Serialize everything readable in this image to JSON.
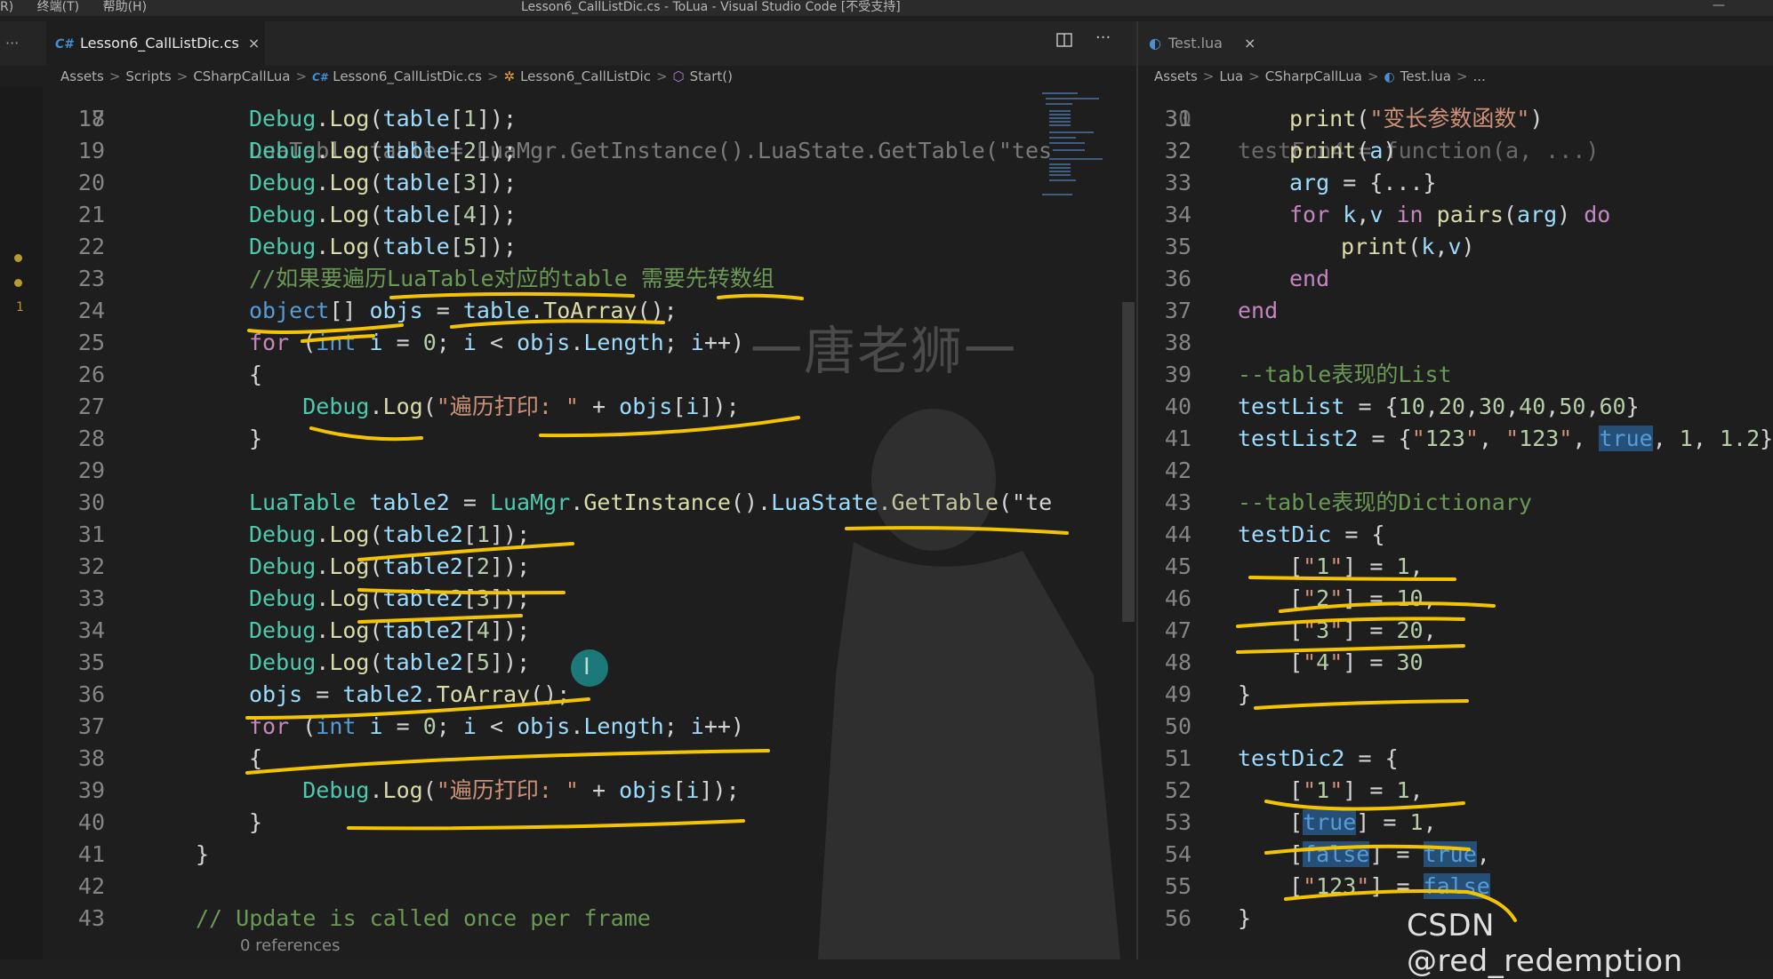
{
  "titlebar": {
    "menu": [
      "R)",
      "终端(T)",
      "帮助(H)"
    ],
    "title": "Lesson6_CallListDic.cs - ToLua - Visual Studio Code [不受支持]",
    "minimize": "—"
  },
  "left_editor": {
    "tab_icon": "C#",
    "tab_label": "Lesson6_CallListDic.cs",
    "tab_close": "×",
    "split_icon": "split-editor-icon",
    "more_icon": "···",
    "breadcrumb": [
      "Assets",
      "Scripts",
      "CSharpCallLua",
      "Lesson6_CallListDic.cs",
      "Lesson6_CallListDic",
      "Start()"
    ],
    "partial_top_line": "LuaTable table = LuaMgr.GetInstance().LuaState.GetTable(\"tes",
    "lines": [
      {
        "n": "18",
        "t": "Debug.Log(table[1]);"
      },
      {
        "n": "19",
        "t": "Debug.Log(table[2]);"
      },
      {
        "n": "20",
        "t": "Debug.Log(table[3]);"
      },
      {
        "n": "21",
        "t": "Debug.Log(table[4]);"
      },
      {
        "n": "22",
        "t": "Debug.Log(table[5]);"
      },
      {
        "n": "23",
        "t": "//如果要遍历LuaTable对应的table 需要先转数组"
      },
      {
        "n": "24",
        "t": "object[] objs = table.ToArray();"
      },
      {
        "n": "25",
        "t": "for (int i = 0; i < objs.Length; i++)"
      },
      {
        "n": "26",
        "t": "{"
      },
      {
        "n": "27",
        "t": "    Debug.Log(\"遍历打印: \" + objs[i]);"
      },
      {
        "n": "28",
        "t": "}"
      },
      {
        "n": "29",
        "t": ""
      },
      {
        "n": "30",
        "t": "LuaTable table2 = LuaMgr.GetInstance().LuaState.GetTable(\"te"
      },
      {
        "n": "31",
        "t": "Debug.Log(table2[1]);"
      },
      {
        "n": "32",
        "t": "Debug.Log(table2[2]);"
      },
      {
        "n": "33",
        "t": "Debug.Log(table2[3]);"
      },
      {
        "n": "34",
        "t": "Debug.Log(table2[4]);"
      },
      {
        "n": "35",
        "t": "Debug.Log(table2[5]);"
      },
      {
        "n": "36",
        "t": "objs = table2.ToArray();"
      },
      {
        "n": "37",
        "t": "for (int i = 0; i < objs.Length; i++)"
      },
      {
        "n": "38",
        "t": "{"
      },
      {
        "n": "39",
        "t": "    Debug.Log(\"遍历打印: \" + objs[i]);"
      },
      {
        "n": "40",
        "t": "}"
      },
      {
        "n": "41",
        "t": "}"
      },
      {
        "n": "42",
        "t": ""
      },
      {
        "n": "43",
        "t": "// Update is called once per frame"
      }
    ],
    "codelens": "0 references"
  },
  "right_editor": {
    "tab_label": "Test.lua",
    "tab_close": "×",
    "breadcrumb": [
      "Assets",
      "Lua",
      "CSharpCallLua",
      "Test.lua",
      "..."
    ],
    "lines": [
      {
        "n": "31",
        "t": "print(\"变长参数函数\")"
      },
      {
        "n": "32",
        "t": "print(a)"
      },
      {
        "n": "33",
        "t": "arg = {...}"
      },
      {
        "n": "34",
        "t": "for k,v in pairs(arg) do"
      },
      {
        "n": "35",
        "t": "print(k,v)"
      },
      {
        "n": "36",
        "t": "end"
      },
      {
        "n": "37",
        "t": "end"
      },
      {
        "n": "38",
        "t": ""
      },
      {
        "n": "39",
        "t": "--table表现的List"
      },
      {
        "n": "40",
        "t": "testList = {10,20,30,40,50,60}"
      },
      {
        "n": "41",
        "t": "testList2 = {\"123\", \"123\", true, 1, 1.2}"
      },
      {
        "n": "42",
        "t": ""
      },
      {
        "n": "43",
        "t": "--table表现的Dictionary"
      },
      {
        "n": "44",
        "t": "testDic = {"
      },
      {
        "n": "45",
        "t": "[\"1\"] = 1,"
      },
      {
        "n": "46",
        "t": "[\"2\"] = 10,"
      },
      {
        "n": "47",
        "t": "[\"3\"] = 20,"
      },
      {
        "n": "48",
        "t": "[\"4\"] = 30"
      },
      {
        "n": "49",
        "t": "}"
      },
      {
        "n": "50",
        "t": ""
      },
      {
        "n": "51",
        "t": "testDic2 = {"
      },
      {
        "n": "52",
        "t": "[\"1\"] = 1,"
      },
      {
        "n": "53",
        "t": "[true] = 1,"
      },
      {
        "n": "54",
        "t": "[false] = true,"
      },
      {
        "n": "55",
        "t": "[\"123\"] = false"
      },
      {
        "n": "56",
        "t": "}"
      }
    ]
  },
  "overlay": {
    "watermark": "一唐老狮一",
    "credit": "CSDN @red_redemption",
    "cursor_glyph": "I"
  },
  "colors": {
    "annotation_yellow": "#f5c400",
    "keyword": "#569cd6",
    "type": "#4ec9b0",
    "function": "#dcdcaa",
    "string": "#ce9178",
    "comment": "#6a9955"
  }
}
